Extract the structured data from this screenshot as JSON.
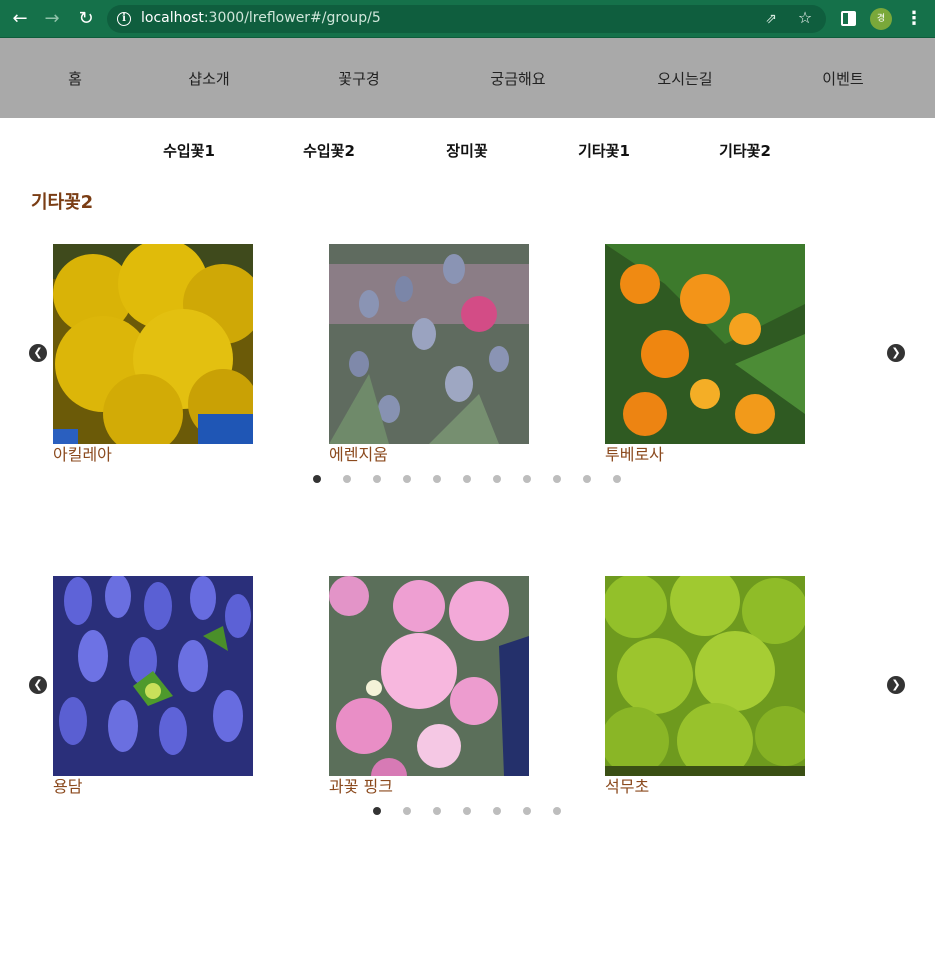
{
  "browser": {
    "url_host": "localhost",
    "url_path": ":3000/lreflower#/group/5",
    "avatar_letter": "경"
  },
  "site_nav": {
    "items": [
      "홈",
      "샵소개",
      "꽃구경",
      "궁금해요",
      "오시는길",
      "이벤트"
    ]
  },
  "sub_nav": {
    "items": [
      "수입꽃1",
      "수입꽃2",
      "장미꽃",
      "기타꽃1",
      "기타꽃2"
    ]
  },
  "group_title": "기타꽃2",
  "carousels": [
    {
      "cards": [
        {
          "label": "아킬레아",
          "photo": "yellow-achillea-photo"
        },
        {
          "label": "에렌지움",
          "photo": "blue-eryngium-photo"
        },
        {
          "label": "투베로사",
          "photo": "orange-tuberosa-photo"
        }
      ],
      "dot_count": 11,
      "active_dot": 0
    },
    {
      "cards": [
        {
          "label": "용담",
          "photo": "blue-gentian-photo"
        },
        {
          "label": "과꽃 핑크",
          "photo": "pink-aster-photo"
        },
        {
          "label": "석무초",
          "photo": "green-foliage-photo"
        }
      ],
      "dot_count": 7,
      "active_dot": 0
    }
  ],
  "colors": {
    "browser_green": "#15714a",
    "nav_gray": "#a9a9a9",
    "label_brown": "#8b4a1e",
    "title_brown": "#7a3d14",
    "active_dot": "#333333",
    "inactive_dot": "#bdbdbd"
  },
  "icons": [
    "back-arrow-icon",
    "forward-arrow-icon",
    "reload-icon",
    "info-icon",
    "share-icon",
    "star-icon",
    "side-panel-icon",
    "kebab-menu-icon",
    "chevron-left-icon",
    "chevron-right-icon"
  ]
}
